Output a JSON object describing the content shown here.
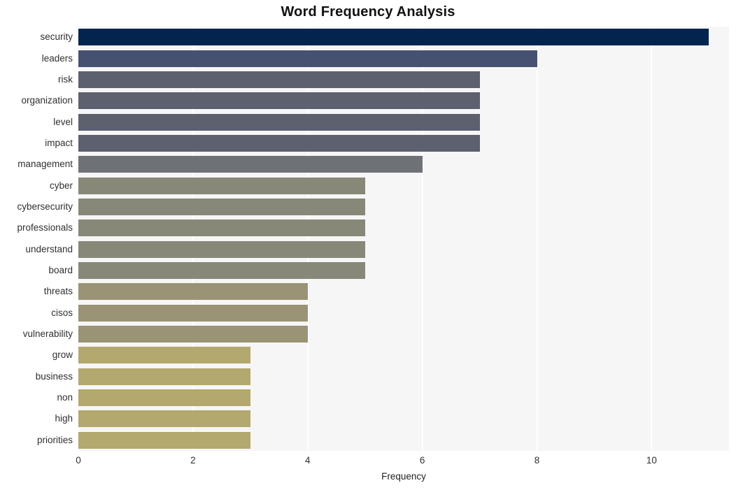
{
  "chart_data": {
    "type": "bar",
    "orientation": "horizontal",
    "title": "Word Frequency Analysis",
    "xlabel": "Frequency",
    "ylabel": "",
    "categories": [
      "security",
      "leaders",
      "risk",
      "organization",
      "level",
      "impact",
      "management",
      "cyber",
      "cybersecurity",
      "professionals",
      "understand",
      "board",
      "threats",
      "cisos",
      "vulnerability",
      "grow",
      "business",
      "non",
      "high",
      "priorities"
    ],
    "values": [
      11,
      8,
      7,
      7,
      7,
      7,
      6,
      5,
      5,
      5,
      5,
      5,
      4,
      4,
      4,
      3,
      3,
      3,
      3,
      3
    ],
    "bar_colors": [
      "#042450",
      "#465172",
      "#5c606f",
      "#5c606f",
      "#5c606f",
      "#5c606f",
      "#6e7176",
      "#878878",
      "#878878",
      "#878878",
      "#878878",
      "#878878",
      "#9a9376",
      "#9a9376",
      "#9a9376",
      "#b3a86d",
      "#b3a86d",
      "#b3a86d",
      "#b3a86d",
      "#b3a86d"
    ],
    "xlim": [
      0,
      11.35
    ],
    "xticks": [
      0,
      2,
      4,
      6,
      8,
      10
    ],
    "grid": true,
    "grid_axis": "x",
    "grid_color": "#ffffff",
    "plot_background": "#f6f6f7",
    "figure_background": "#ffffff",
    "legend": null
  }
}
